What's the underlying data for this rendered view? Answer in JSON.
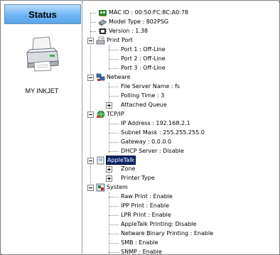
{
  "status_panel": {
    "title": "Status",
    "printer_name": "MY INKJET"
  },
  "tree": {
    "mac_id": "MAC ID : 00:50:FC:8C:A0:78",
    "model_type": "Model Type : 802PSG",
    "version": "Version : 1.38",
    "print_port": {
      "label": "Print Port",
      "ports": [
        "Port 1 : Off-Line",
        "Port 2 : Off-Line",
        "Port 3 : Off-Line"
      ]
    },
    "netware": {
      "label": "Netware",
      "items": [
        "File Server Name : fs",
        "Polling Time : 3",
        "Attached Queue"
      ]
    },
    "tcpip": {
      "label": "TCP/IP",
      "items": [
        "IP Address : 192.168.2.1",
        "Subnet Mask : 255.255.255.0",
        "Gateway : 0.0.0.0",
        "DHCP Server : Disable"
      ]
    },
    "appletalk": {
      "label": "AppleTalk",
      "items": [
        "Zone",
        "Printer Type"
      ]
    },
    "system": {
      "label": "System",
      "items": [
        "Raw Print : Enable",
        "IPP Print : Enable",
        "LPR Print : Enable",
        "AppleTalk Printing: Disable",
        "Netware Binary Printing : Enable",
        "SMB : Enable",
        "SNMP : Enable"
      ]
    }
  }
}
